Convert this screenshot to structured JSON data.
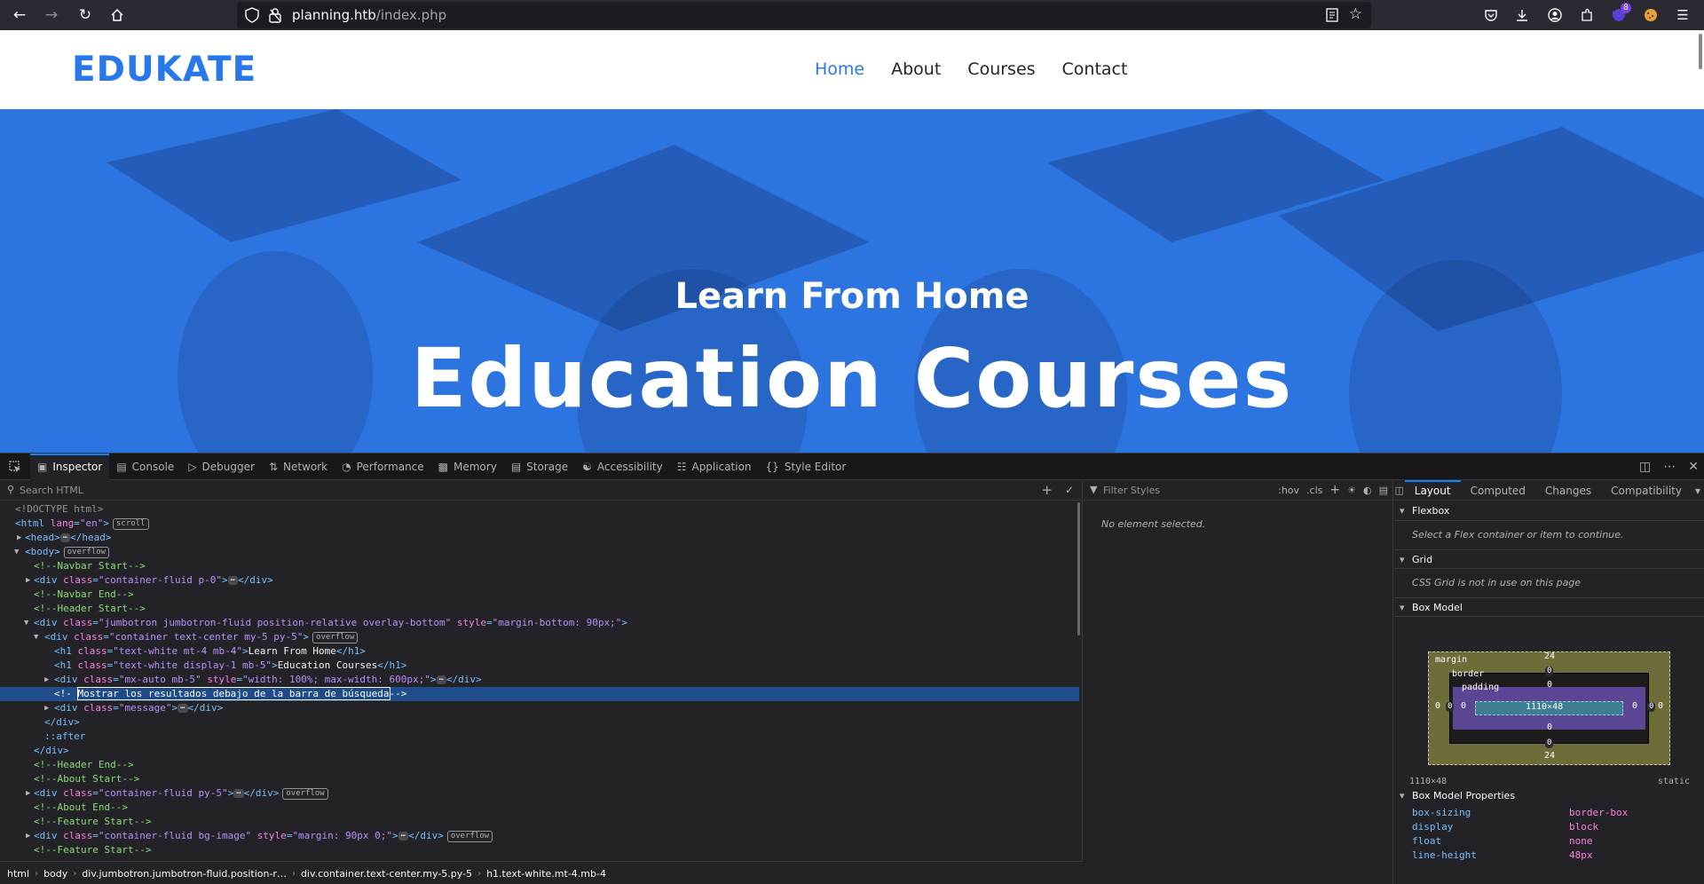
{
  "browser": {
    "url_host": "planning.htb",
    "url_path": "/index.php",
    "extensions_badge": "8"
  },
  "site": {
    "logo": "EDUKATE",
    "nav": [
      "Home",
      "About",
      "Courses",
      "Contact"
    ],
    "hero_sub": "Learn From Home",
    "hero_title": "Education Courses"
  },
  "devtools": {
    "tabs": [
      {
        "label": "Inspector",
        "icon": "inspector-icon"
      },
      {
        "label": "Console",
        "icon": "console-icon"
      },
      {
        "label": "Debugger",
        "icon": "debugger-icon"
      },
      {
        "label": "Network",
        "icon": "network-icon"
      },
      {
        "label": "Performance",
        "icon": "performance-icon"
      },
      {
        "label": "Memory",
        "icon": "memory-icon"
      },
      {
        "label": "Storage",
        "icon": "storage-icon"
      },
      {
        "label": "Accessibility",
        "icon": "accessibility-icon"
      },
      {
        "label": "Application",
        "icon": "application-icon"
      },
      {
        "label": "Style Editor",
        "icon": "style-editor-icon"
      }
    ],
    "search_placeholder": "Search HTML",
    "filter_placeholder": "Filter Styles",
    "hov": ":hov",
    "cls": ".cls",
    "no_element": "No element selected.",
    "side_tabs": [
      "Layout",
      "Computed",
      "Changes",
      "Compatibility"
    ],
    "flexbox_title": "Flexbox",
    "flexbox_note": "Select a Flex container or item to continue.",
    "grid_title": "Grid",
    "grid_note": "CSS Grid is not in use on this page",
    "boxmodel_title": "Box Model",
    "boxmodel": {
      "margin_label": "margin",
      "border_label": "border",
      "padding_label": "padding",
      "margin_top": "24",
      "margin_bottom": "24",
      "margin_left": "0",
      "margin_right": "0",
      "border_top": "0",
      "border_bottom": "0",
      "border_left": "0",
      "border_right": "0",
      "padding_top": "0",
      "padding_bottom": "0",
      "padding_left": "0",
      "padding_right": "0",
      "content": "1110×48",
      "size": "1110×48",
      "position": "static"
    },
    "props_title": "Box Model Properties",
    "props": [
      {
        "name": "box-sizing",
        "value": "border-box"
      },
      {
        "name": "display",
        "value": "block"
      },
      {
        "name": "float",
        "value": "none"
      },
      {
        "name": "line-height",
        "value": "48px"
      }
    ],
    "breadcrumbs": [
      "html",
      "body",
      "div.jumbotron.jumbotron-fluid.position-r…",
      "div.container.text-center.my-5.py-5",
      "h1.text-white.mt-4.mb-4"
    ],
    "tree": {
      "doctype": "<!DOCTYPE html>",
      "html_lang": "\"en\"",
      "badge_scroll": "scroll",
      "badge_overflow": "overflow",
      "c_navbar_start": "<!--Navbar Start-->",
      "div_container_p0": "\"container-fluid p-0\"",
      "c_navbar_end": "<!--Navbar End-->",
      "c_header_start": "<!--Header Start-->",
      "div_jumbotron_class": "\"jumbotron jumbotron-fluid position-relative overlay-bottom\"",
      "div_jumbotron_style": "\"margin-bottom: 90px;\"",
      "div_container_class": "\"container text-center my-5 py-5\"",
      "h1_small_class": "\"text-white mt-4 mb-4\"",
      "h1_small_text": "Learn From Home",
      "h1_big_class": "\"text-white display-1 mb-5\"",
      "h1_big_text": "Education Courses",
      "div_mx_class": "\"mx-auto mb-5\"",
      "div_mx_style": "\"width: 100%; max-width: 600px;\"",
      "comment_selected": "Mostrar los resultados debajo de la barra de búsqueda",
      "div_message_class": "\"message\"",
      "after": "::after",
      "c_header_end": "<!--Header End-->",
      "c_about_start": "<!--About Start-->",
      "div_py5_class": "\"container-fluid py-5\"",
      "c_about_end": "<!--About End-->",
      "c_feature_start": "<!--Feature Start-->",
      "div_bgimage_class": "\"container-fluid bg-image\"",
      "div_bgimage_style": "\"margin: 90px 0;\"",
      "c_feature_start2": "<!--Feature Start-->"
    }
  }
}
